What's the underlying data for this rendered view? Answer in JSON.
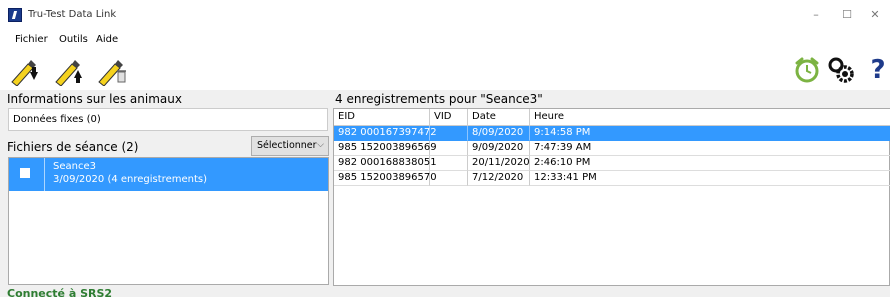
{
  "window": {
    "title": "Tru-Test Data Link",
    "minimize": "–",
    "maximize": "☐",
    "close": "✕"
  },
  "menu": {
    "items": [
      "Fichier",
      "Outils",
      "Aide"
    ]
  },
  "toolbar": {
    "tools": [
      {
        "icon": "download-to-pc-icon"
      },
      {
        "icon": "upload-to-device-icon"
      },
      {
        "icon": "delete-from-device-icon"
      }
    ],
    "right_tools": [
      {
        "icon": "alarm-clock-icon"
      },
      {
        "icon": "settings-gears-icon"
      },
      {
        "icon": "help-icon",
        "label": "?"
      }
    ]
  },
  "left_panel": {
    "header": "Informations sur les animaux",
    "fixed_data": "Données fixes (0)",
    "sessions_header": "Fichiers de séance (2)",
    "select_label": "Sélectionner",
    "sessions": [
      {
        "name": "Seance3",
        "info": "3/09/2020  (4 enregistrements)",
        "selected": true,
        "checked": false
      }
    ]
  },
  "records": {
    "header": "4 enregistrements pour \"Seance3\"",
    "columns": [
      "EID",
      "VID",
      "Date",
      "Heure"
    ],
    "rows": [
      {
        "eid": "982 000167397472",
        "vid": "",
        "date": "8/09/2020",
        "time": "9:14:58 PM",
        "selected": true
      },
      {
        "eid": "985 152003896569",
        "vid": "",
        "date": "9/09/2020",
        "time": "7:47:39 AM",
        "selected": false
      },
      {
        "eid": "982 000168838051",
        "vid": "",
        "date": "20/11/2020",
        "time": "2:46:10 PM",
        "selected": false
      },
      {
        "eid": "985 152003896570",
        "vid": "",
        "date": "7/12/2020",
        "time": "12:33:41 PM",
        "selected": false
      }
    ]
  },
  "status": {
    "text": "Connecté à SRS2",
    "color": "#2e7d32"
  },
  "colors": {
    "selection": "#3399ff",
    "wand_yellow": "#f5d21e",
    "clock_green": "#7cb342",
    "help_blue": "#1e3a8a"
  }
}
